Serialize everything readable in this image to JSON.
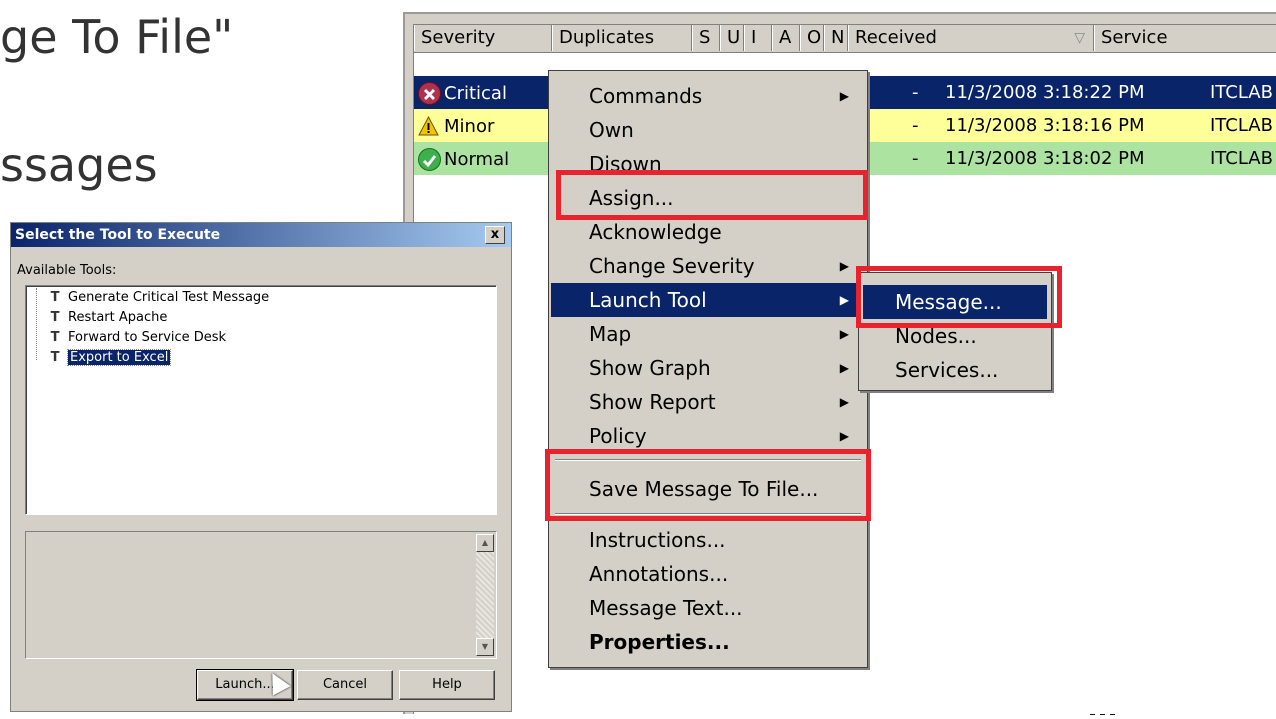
{
  "slide": {
    "title_line1": "ge To File\"",
    "title_line2": "ssages"
  },
  "grid": {
    "columns": [
      "Severity",
      "Duplicates",
      "S",
      "U",
      "I",
      "A",
      "O",
      "N",
      "Received",
      "Service"
    ],
    "sort_indicator": "▽",
    "rows": [
      {
        "severity": "Critical",
        "status_mark": "x",
        "n_mark": "-",
        "received": "11/3/2008  3:18:22 PM",
        "service": "ITCLAB",
        "icon": "critical-x-icon",
        "color": "#0a246a"
      },
      {
        "severity": "Minor",
        "status_mark": "",
        "n_mark": "-",
        "received": "11/3/2008  3:18:16 PM",
        "service": "ITCLAB",
        "icon": "warning-triangle-icon",
        "color": "#ffff99"
      },
      {
        "severity": "Normal",
        "status_mark": "",
        "n_mark": "-",
        "received": "11/3/2008  3:18:02 PM",
        "service": "ITCLAB",
        "icon": "check-circle-icon",
        "color": "#ace3a0"
      }
    ]
  },
  "context_menu": {
    "items": [
      {
        "label": "Commands",
        "submenu": true
      },
      {
        "label": "Own",
        "submenu": false
      },
      {
        "label": "Disown",
        "submenu": false
      },
      {
        "label": "Assign...",
        "submenu": false
      },
      {
        "label": "Acknowledge",
        "submenu": false
      },
      {
        "label": "Change Severity",
        "submenu": true
      },
      {
        "label": "Launch Tool",
        "submenu": true
      },
      {
        "label": "Map",
        "submenu": true
      },
      {
        "label": "Show Graph",
        "submenu": true
      },
      {
        "label": "Show Report",
        "submenu": true
      },
      {
        "label": "Policy",
        "submenu": true
      },
      {
        "label": "Save Message To File...",
        "submenu": false
      },
      {
        "label": "Instructions...",
        "submenu": false
      },
      {
        "label": "Annotations...",
        "submenu": false
      },
      {
        "label": "Message Text...",
        "submenu": false
      },
      {
        "label": "Properties...",
        "submenu": false
      }
    ],
    "highlighted": "Launch Tool"
  },
  "launch_submenu": {
    "items": [
      "Message...",
      "Nodes...",
      "Services..."
    ],
    "highlighted": "Message..."
  },
  "dialog": {
    "title": "Select the Tool to Execute",
    "close": "x",
    "available_label": "Available Tools:",
    "tools": [
      "Generate Critical Test Message",
      "Restart Apache",
      "Forward to Service Desk",
      "Export to Excel"
    ],
    "selected_tool": "Export to Excel",
    "buttons": {
      "launch": "Launch...",
      "cancel": "Cancel",
      "help": "Help"
    }
  },
  "colors": {
    "highlight": "#0a246a",
    "annotation": "#e8232e",
    "logo": "#ffff00"
  }
}
